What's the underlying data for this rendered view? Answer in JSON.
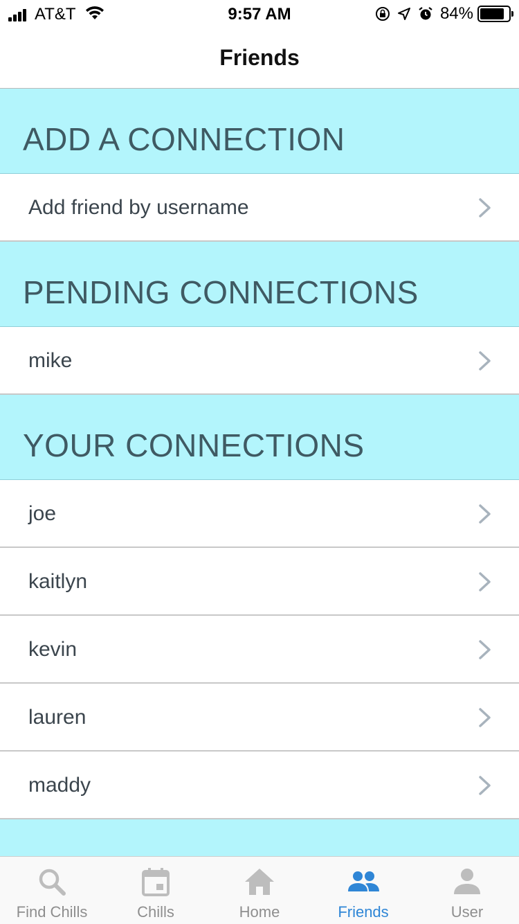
{
  "status_bar": {
    "carrier": "AT&T",
    "time": "9:57 AM",
    "battery_percent": "84%",
    "battery_level": 0.84
  },
  "nav": {
    "title": "Friends"
  },
  "sections": {
    "add": {
      "header": "ADD A CONNECTION",
      "rows": [
        {
          "label": "Add friend by username"
        }
      ]
    },
    "pending": {
      "header": "PENDING CONNECTIONS",
      "rows": [
        {
          "label": "mike"
        }
      ]
    },
    "yours": {
      "header": "YOUR CONNECTIONS",
      "rows": [
        {
          "label": "joe"
        },
        {
          "label": "kaitlyn"
        },
        {
          "label": "kevin"
        },
        {
          "label": "lauren"
        },
        {
          "label": "maddy"
        }
      ]
    }
  },
  "tabs": [
    {
      "label": "Find Chills",
      "icon": "search-icon",
      "active": false
    },
    {
      "label": "Chills",
      "icon": "calendar-icon",
      "active": false
    },
    {
      "label": "Home",
      "icon": "home-icon",
      "active": false
    },
    {
      "label": "Friends",
      "icon": "people-icon",
      "active": true
    },
    {
      "label": "User",
      "icon": "person-icon",
      "active": false
    }
  ],
  "colors": {
    "section_header_bg": "#b3f5fc",
    "section_header_text": "#3f5a63",
    "active_tab": "#2f86d6",
    "inactive_tab": "#8e8e8e",
    "chevron": "#a8b3bd"
  }
}
